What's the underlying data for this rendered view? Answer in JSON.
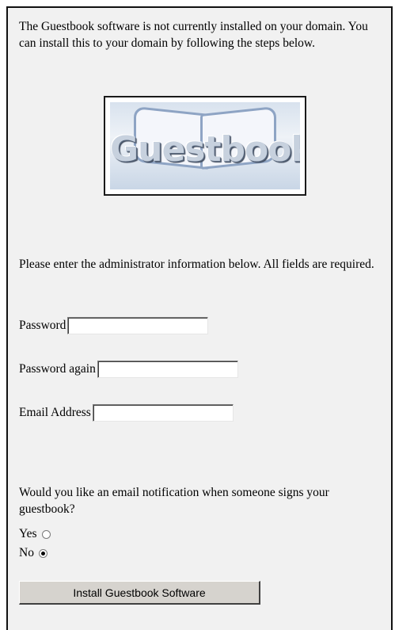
{
  "intro_text": "The Guestbook software is not currently installed on your domain. You can install this to your domain by following the steps below.",
  "logo": {
    "text": "Guestbook"
  },
  "admin_info_text": "Please enter the administrator information below. All fields are required.",
  "form": {
    "password_label": "Password",
    "password_value": "",
    "password_again_label": "Password again",
    "password_again_value": "",
    "email_label": "Email Address",
    "email_value": ""
  },
  "notification": {
    "question": "Would you like an email notification when someone signs your guestbook?",
    "yes_label": "Yes",
    "no_label": "No",
    "selected": "No"
  },
  "install_button_label": "Install Guestbook Software"
}
